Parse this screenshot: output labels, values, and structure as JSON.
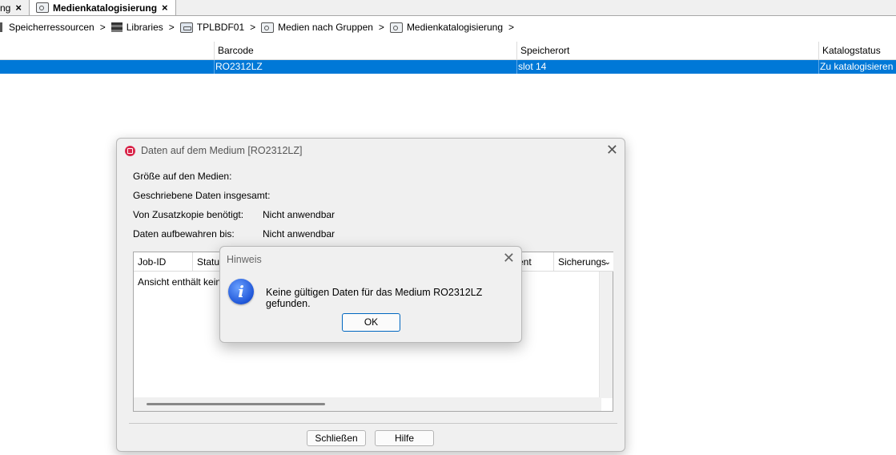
{
  "tabs": {
    "prev_label": "ng",
    "active_label": "Medienkatalogisierung",
    "close_glyph": "×"
  },
  "breadcrumb": {
    "items": [
      "Speicherressourcen",
      "Libraries",
      "TPLBDF01",
      "Medien nach Gruppen",
      "Medienkatalogisierung"
    ],
    "separator": ">"
  },
  "table": {
    "columns": [
      "Barcode",
      "Speicherort",
      "Katalogstatus"
    ],
    "rows": [
      {
        "barcode": "RO2312LZ",
        "location": "slot 14",
        "status": "Zu katalogisieren"
      }
    ],
    "selected_color": "#0078d7"
  },
  "media_dialog": {
    "title": "Daten auf dem Medium [RO2312LZ]",
    "fields": [
      {
        "label": "Größe auf den Medien:",
        "value": ""
      },
      {
        "label": "Geschriebene Daten insgesamt:",
        "value": ""
      },
      {
        "label": "Von Zusatzkopie benötigt:",
        "value": "Nicht anwendbar"
      },
      {
        "label": "Daten aufbewahren bis:",
        "value": "Nicht anwendbar"
      }
    ],
    "inner_columns": [
      "Job-ID",
      "Status",
      "ent",
      "Sicherungs"
    ],
    "empty_text": "Ansicht enthält keine",
    "close_button": "Schließen",
    "help_button": "Hilfe",
    "accent": "#d9264a"
  },
  "hint_dialog": {
    "title": "Hinweis",
    "message": "Keine gültigen Daten für das Medium RO2312LZ gefunden.",
    "ok_button": "OK",
    "icon": "info-icon"
  }
}
